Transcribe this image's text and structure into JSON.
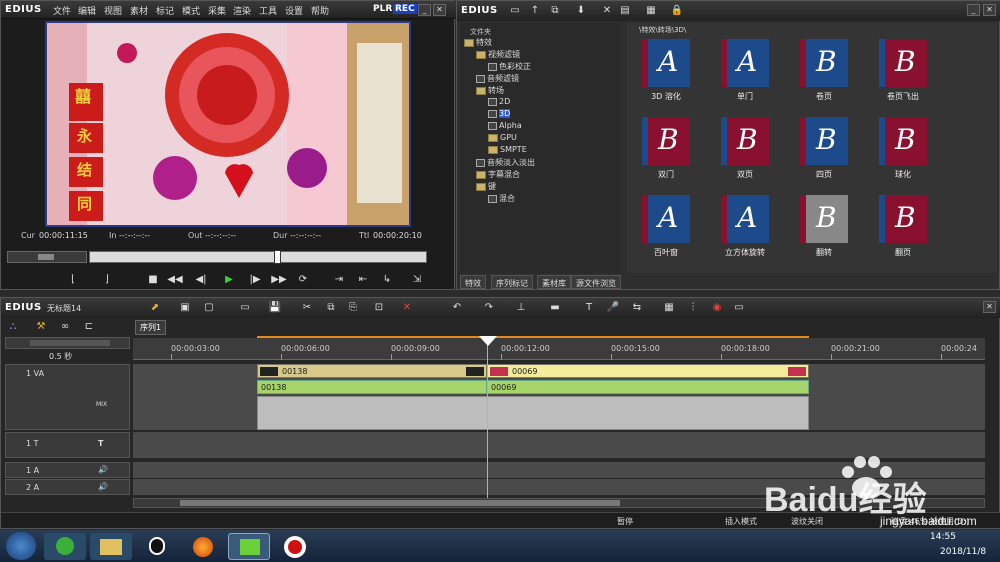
{
  "player": {
    "brand": "EDIUS",
    "menu": [
      "文件",
      "编辑",
      "视图",
      "素材",
      "标记",
      "模式",
      "采集",
      "渲染",
      "工具",
      "设置",
      "帮助"
    ],
    "plr": "PLR",
    "rec": "REC",
    "timecodes": {
      "cur_label": "Cur",
      "cur": "00:00:11:15",
      "in_label": "In",
      "in": "--:--:--:--",
      "out_label": "Out",
      "out": "--:--:--:--",
      "dur_label": "Dur",
      "dur": "--:--:--:--",
      "ttl_label": "Ttl",
      "ttl": "00:00:20:10"
    },
    "video_text": {
      "wedding_char": "囍",
      "couplet": [
        "永",
        "结",
        "同"
      ]
    }
  },
  "bin": {
    "brand": "EDIUS",
    "tree_header": "文件夹",
    "tree": [
      {
        "label": "特效",
        "indent": 0,
        "icon": "folder"
      },
      {
        "label": "视频滤镜",
        "indent": 1,
        "icon": "folder"
      },
      {
        "label": "色彩校正",
        "indent": 2,
        "icon": "fx"
      },
      {
        "label": "音频滤镜",
        "indent": 1,
        "icon": "fx"
      },
      {
        "label": "转场",
        "indent": 1,
        "icon": "folder"
      },
      {
        "label": "2D",
        "indent": 2,
        "icon": "fx"
      },
      {
        "label": "3D",
        "indent": 2,
        "icon": "fx",
        "selected": true
      },
      {
        "label": "Alpha",
        "indent": 2,
        "icon": "fx"
      },
      {
        "label": "GPU",
        "indent": 2,
        "icon": "folder"
      },
      {
        "label": "SMPTE",
        "indent": 2,
        "icon": "folder"
      },
      {
        "label": "音频淡入淡出",
        "indent": 1,
        "icon": "fx"
      },
      {
        "label": "字幕混合",
        "indent": 1,
        "icon": "folder"
      },
      {
        "label": "键",
        "indent": 1,
        "icon": "folder"
      },
      {
        "label": "混合",
        "indent": 2,
        "icon": "fx"
      }
    ],
    "path": "\\特效\\转场\\3D\\",
    "effects": [
      "3D 溶化",
      "单门",
      "卷页",
      "卷页飞出",
      "双门",
      "双页",
      "四页",
      "球化",
      "百叶窗",
      "立方体旋转",
      "翻转",
      "翻页"
    ],
    "tabs": [
      "特效",
      "序列标记",
      "素材库",
      "源文件浏览"
    ]
  },
  "timeline": {
    "brand": "EDIUS",
    "project": "无标题14",
    "sequence_tab": "序列1",
    "zoom": "0.5 秒",
    "ruler": [
      "00:00:03:00",
      "00:00:06:00",
      "00:00:09:00",
      "00:00:12:00",
      "00:00:15:00",
      "00:00:18:00",
      "00:00:21:00",
      "00:00:24"
    ],
    "tracks": {
      "va": "1 VA",
      "mix": "MIX",
      "t": "1 T",
      "a1": "1 A",
      "a2": "2 A"
    },
    "clips": {
      "v1": "00138",
      "v2": "00069",
      "a1": "00138",
      "a2": "00069"
    },
    "status": [
      "暂停",
      "插入模式",
      "波纹关闭",
      "磁盘:46% 被使用(D:)"
    ]
  },
  "taskbar": {
    "time": "14:55",
    "date": "2018/11/8"
  },
  "watermark": {
    "text": "Baidu经验",
    "url": "jingyan.baidu.com"
  },
  "colors": {
    "thumb_blue": "#1c4a8a",
    "thumb_red": "#8a1030",
    "clip_audio": "#a6d36a",
    "clip_video": "#d7c98a",
    "play_green": "#3ad13a"
  }
}
